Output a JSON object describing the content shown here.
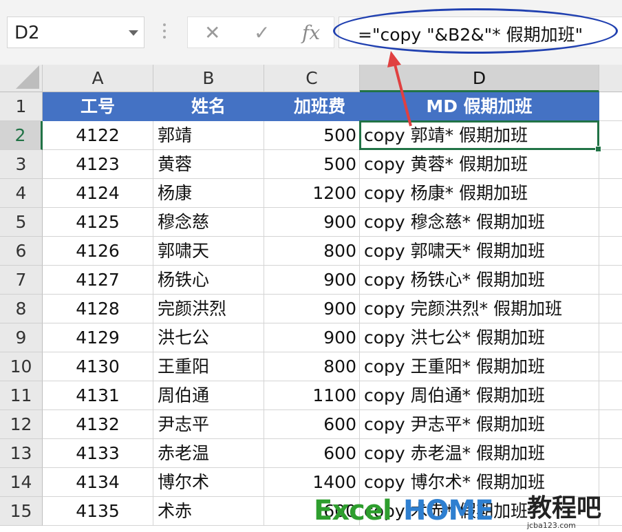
{
  "formula_bar": {
    "name_box": "D2",
    "cancel_symbol": "✕",
    "enter_symbol": "✓",
    "fx_symbol": "fx",
    "formula": "=\"copy \"&B2&\"* 假期加班\""
  },
  "columns": [
    "A",
    "B",
    "C",
    "D"
  ],
  "selected_cell": "D2",
  "rows": [
    {
      "n": "1",
      "a": "工号",
      "b": "姓名",
      "c": "加班费",
      "d": "MD 假期加班"
    },
    {
      "n": "2",
      "a": "4122",
      "b": "郭靖",
      "c": "500",
      "d": "copy 郭靖* 假期加班"
    },
    {
      "n": "3",
      "a": "4123",
      "b": "黄蓉",
      "c": "500",
      "d": "copy 黄蓉* 假期加班"
    },
    {
      "n": "4",
      "a": "4124",
      "b": "杨康",
      "c": "1200",
      "d": "copy 杨康* 假期加班"
    },
    {
      "n": "5",
      "a": "4125",
      "b": "穆念慈",
      "c": "900",
      "d": "copy 穆念慈* 假期加班"
    },
    {
      "n": "6",
      "a": "4126",
      "b": "郭啸天",
      "c": "800",
      "d": "copy 郭啸天* 假期加班"
    },
    {
      "n": "7",
      "a": "4127",
      "b": "杨铁心",
      "c": "900",
      "d": "copy 杨铁心* 假期加班"
    },
    {
      "n": "8",
      "a": "4128",
      "b": "完颜洪烈",
      "c": "900",
      "d": "copy 完颜洪烈* 假期加班"
    },
    {
      "n": "9",
      "a": "4129",
      "b": "洪七公",
      "c": "900",
      "d": "copy 洪七公* 假期加班"
    },
    {
      "n": "10",
      "a": "4130",
      "b": "王重阳",
      "c": "800",
      "d": "copy 王重阳* 假期加班"
    },
    {
      "n": "11",
      "a": "4131",
      "b": "周伯通",
      "c": "1100",
      "d": "copy 周伯通* 假期加班"
    },
    {
      "n": "12",
      "a": "4132",
      "b": "尹志平",
      "c": "600",
      "d": "copy 尹志平* 假期加班"
    },
    {
      "n": "13",
      "a": "4133",
      "b": "赤老温",
      "c": "600",
      "d": "copy 赤老温* 假期加班"
    },
    {
      "n": "14",
      "a": "4134",
      "b": "博尔术",
      "c": "1400",
      "d": "copy 博尔术* 假期加班"
    },
    {
      "n": "15",
      "a": "4135",
      "b": "术赤",
      "c": "600",
      "d": "copy 术赤* 假期加班"
    }
  ],
  "watermark": {
    "excel": "Excel",
    "home": "HOME",
    "site_name": "教程吧",
    "site_url": "jcba123.com"
  },
  "colors": {
    "header_fill": "#4472c4",
    "selection_green": "#217346",
    "annotation_blue": "#2040b0",
    "annotation_red": "#e04040"
  }
}
